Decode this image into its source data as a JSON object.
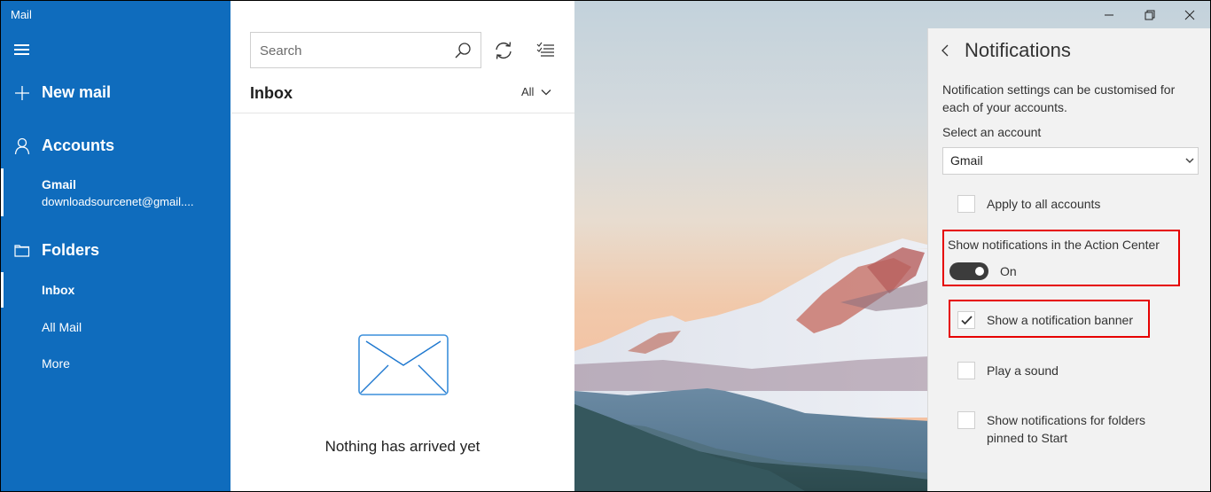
{
  "app": {
    "title": "Mail"
  },
  "nav": {
    "new_mail": "New mail",
    "accounts": "Accounts",
    "account": {
      "name": "Gmail",
      "email": "downloadsourcenet@gmail...."
    },
    "folders": "Folders",
    "folder_items": [
      {
        "label": "Inbox",
        "selected": true
      },
      {
        "label": "All Mail",
        "selected": false
      },
      {
        "label": "More",
        "selected": false
      }
    ]
  },
  "list": {
    "search_placeholder": "Search",
    "search_value": "",
    "folder_title": "Inbox",
    "filter": "All",
    "empty_message": "Nothing has arrived yet"
  },
  "settings": {
    "title": "Notifications",
    "description": "Notification settings can be customised for each of your accounts.",
    "select_label": "Select an account",
    "selected_account": "Gmail",
    "apply_all": {
      "label": "Apply to all accounts",
      "checked": false
    },
    "action_center": {
      "label": "Show notifications in the Action Center",
      "state": "On",
      "on": true
    },
    "banner": {
      "label": "Show a notification banner",
      "checked": true
    },
    "sound": {
      "label": "Play a sound",
      "checked": false
    },
    "pinned": {
      "label": "Show notifications for folders pinned to Start",
      "checked": false
    }
  },
  "colors": {
    "accent": "#0f6cbd",
    "highlight": "#e60000",
    "toggle_on": "#3c3c3c",
    "settings_bg": "#f2f2f2"
  }
}
